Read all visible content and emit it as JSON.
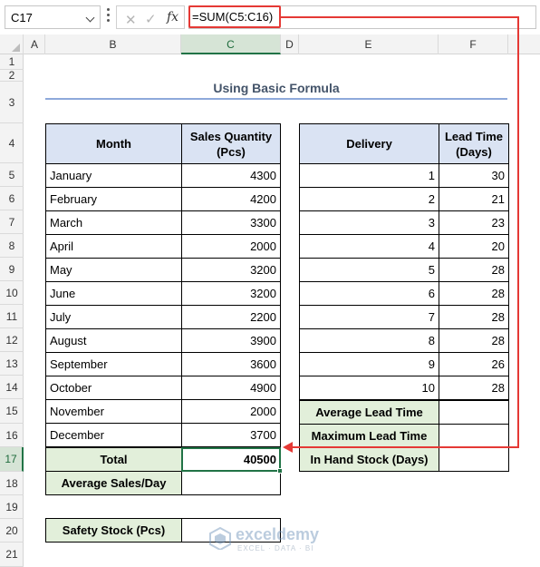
{
  "formula_bar": {
    "name_box": "C17",
    "formula": "=SUM(C5:C16)",
    "fx_label": "fx",
    "cancel_glyph": "✕",
    "enter_glyph": "✓"
  },
  "columns": [
    "A",
    "B",
    "C",
    "D",
    "E",
    "F"
  ],
  "rows": [
    "1",
    "2",
    "3",
    "4",
    "5",
    "6",
    "7",
    "8",
    "9",
    "10",
    "11",
    "12",
    "13",
    "14",
    "15",
    "16",
    "17",
    "18",
    "19",
    "20",
    "21"
  ],
  "sheet": {
    "title": "Using Basic Formula",
    "sales_table": {
      "headers": [
        "Month",
        "Sales Quantity (Pcs)"
      ],
      "rows": [
        {
          "month": "January",
          "qty": "4300"
        },
        {
          "month": "February",
          "qty": "4200"
        },
        {
          "month": "March",
          "qty": "3300"
        },
        {
          "month": "April",
          "qty": "2000"
        },
        {
          "month": "May",
          "qty": "3200"
        },
        {
          "month": "June",
          "qty": "3200"
        },
        {
          "month": "July",
          "qty": "2200"
        },
        {
          "month": "August",
          "qty": "3900"
        },
        {
          "month": "September",
          "qty": "3600"
        },
        {
          "month": "October",
          "qty": "4900"
        },
        {
          "month": "November",
          "qty": "2000"
        },
        {
          "month": "December",
          "qty": "3700"
        }
      ],
      "total_label": "Total",
      "total_value": "40500",
      "avg_label": "Average Sales/Day",
      "avg_value": "",
      "safety_label": "Safety Stock (Pcs)",
      "safety_value": ""
    },
    "lead_table": {
      "headers": [
        "Delivery",
        "Lead Time (Days)"
      ],
      "rows": [
        {
          "delivery": "1",
          "lead": "30"
        },
        {
          "delivery": "2",
          "lead": "21"
        },
        {
          "delivery": "3",
          "lead": "23"
        },
        {
          "delivery": "4",
          "lead": "20"
        },
        {
          "delivery": "5",
          "lead": "28"
        },
        {
          "delivery": "6",
          "lead": "28"
        },
        {
          "delivery": "7",
          "lead": "28"
        },
        {
          "delivery": "8",
          "lead": "28"
        },
        {
          "delivery": "9",
          "lead": "26"
        },
        {
          "delivery": "10",
          "lead": "28"
        }
      ],
      "summary": [
        {
          "label": "Average Lead Time",
          "value": ""
        },
        {
          "label": "Maximum Lead Time",
          "value": ""
        },
        {
          "label": "In Hand Stock (Days)",
          "value": ""
        }
      ]
    }
  },
  "watermark": {
    "name": "exceldemy",
    "tagline": "EXCEL · DATA · BI"
  },
  "colors": {
    "accent_green": "#217346",
    "header_blue": "#dae3f3",
    "label_green": "#e2efda",
    "callout_red": "#e53935"
  }
}
